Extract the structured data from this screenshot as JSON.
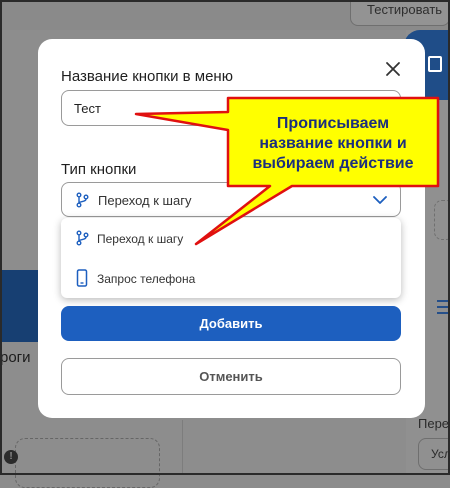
{
  "background": {
    "test_button_label": "Тестировать",
    "left_partial_text": "роги",
    "right_partial_label": "Пере",
    "right_partial_select": "Усл"
  },
  "dialog": {
    "name_label": "Название кнопки в меню",
    "name_value": "Тест",
    "type_label": "Тип кнопки",
    "selected_type": "Переход к шагу",
    "options": [
      {
        "label": "Переход к шагу",
        "icon": "branch-icon"
      },
      {
        "label": "Запрос телефона",
        "icon": "phone-icon"
      }
    ],
    "add_label": "Добавить",
    "cancel_label": "Отменить"
  },
  "callout": {
    "lines": [
      "Прописываем",
      "название кнопки и",
      "выбираем действие"
    ],
    "fill_color": "#ffff00",
    "border_color": "#e01010",
    "text_color": "#1b2f7e"
  },
  "colors": {
    "primary": "#1d5fbf",
    "overlay": "#8d8d8d"
  }
}
